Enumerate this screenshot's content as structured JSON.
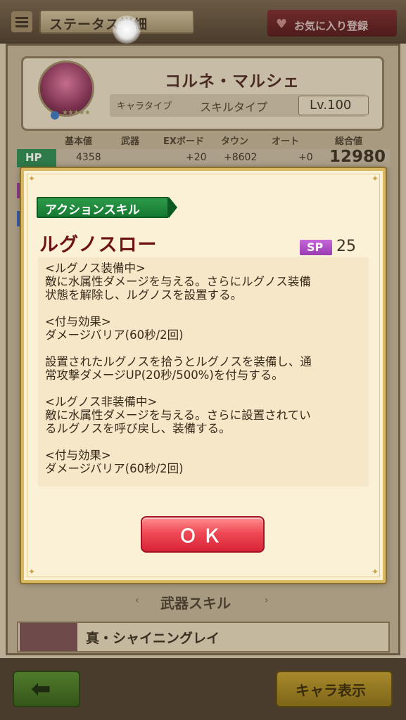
{
  "header": {
    "title": "ステータス詳細",
    "favorite_label": "お気に入り登録"
  },
  "character": {
    "name": "コルネ・マルシェ",
    "chara_type_label": "キャラタイプ",
    "skill_type_label": "スキルタイプ",
    "level": "Lv.100",
    "stars": "★★★★★"
  },
  "stats": {
    "headers": [
      "基本値",
      "武器",
      "EXボード",
      "タウン",
      "オート",
      "総合値"
    ],
    "hp": {
      "label": "HP",
      "base": "4358",
      "ex_board": "+20",
      "town": "+8602",
      "auto": "+0",
      "total": "12980"
    }
  },
  "dialog": {
    "category": "アクションスキル",
    "skill_name": "ルグノスロー",
    "sp_label": "SP",
    "sp_value": "25",
    "description": [
      "<ルグノス装備中>",
      "敵に水属性ダメージを与える。さらにルグノス装備",
      "状態を解除し、ルグノスを設置する。",
      "",
      "<付与効果>",
      "ダメージバリア(60秒/2回)",
      "",
      "設置されたルグノスを拾うとルグノスを装備し、通",
      "常攻撃ダメージUP(20秒/500%)を付与する。",
      "",
      "<ルグノス非装備中>",
      "敵に水属性ダメージを与える。さらに設置されてい",
      "るルグノスを呼び戻し、装備する。",
      "",
      "<付与効果>",
      "ダメージバリア(60秒/2回)"
    ],
    "ok_label": "ＯＫ"
  },
  "weapon_skill": {
    "title": "武器スキル",
    "prev_arrow": "‹",
    "next_arrow": "›",
    "name": "真・シャイニングレイ"
  },
  "footer": {
    "back_icon": "back-arrow-icon",
    "chara_view_label": "キャラ表示"
  },
  "colors": {
    "tag_green": "#167a32",
    "skill_name": "#6e1414",
    "ok_red": "#ef4a55",
    "sp_purple": "#9a3cb0"
  }
}
